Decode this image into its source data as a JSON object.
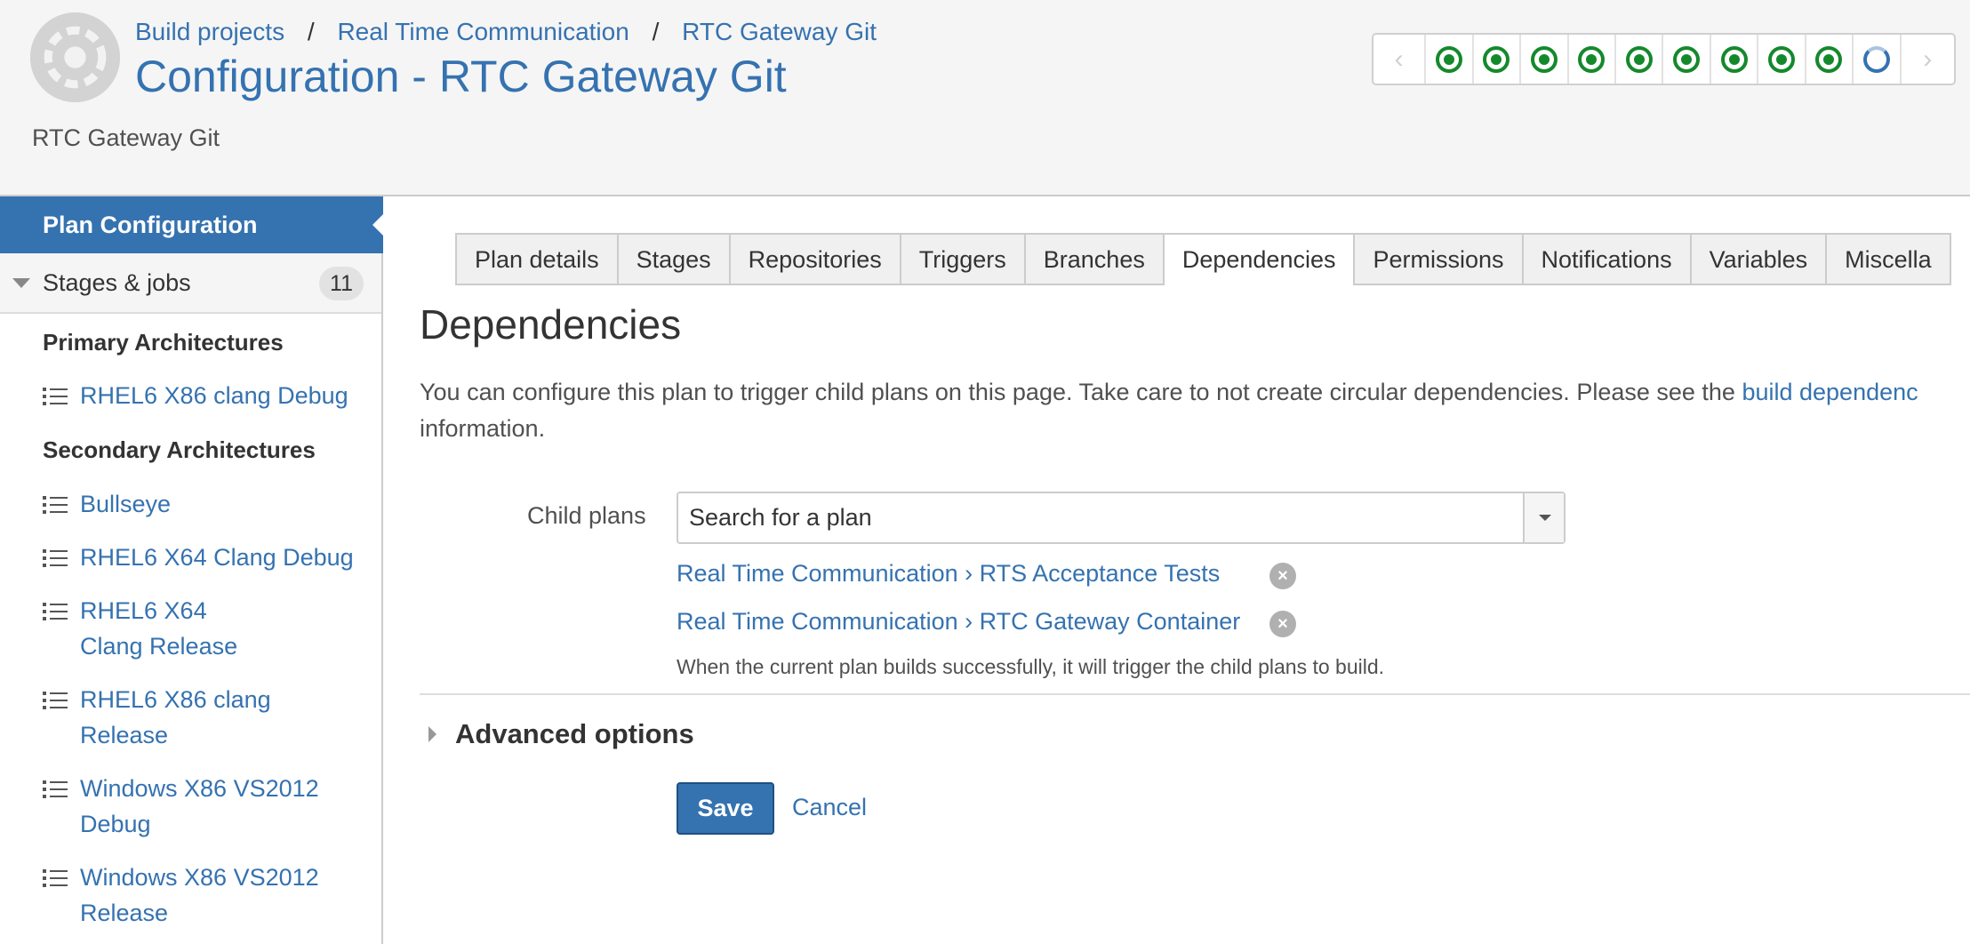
{
  "header": {
    "breadcrumb": [
      "Build projects",
      "Real Time Communication",
      "RTC Gateway Git"
    ],
    "separator": "/",
    "title": "Configuration - RTC Gateway Git",
    "subtitle": "RTC Gateway Git",
    "build_history": {
      "prev_icon": "chevron-left-icon",
      "next_icon": "chevron-right-icon",
      "builds": [
        "success",
        "success",
        "success",
        "success",
        "success",
        "success",
        "success",
        "success",
        "success",
        "in-progress"
      ]
    }
  },
  "sidebar": {
    "active_item": "Plan Configuration",
    "stages": {
      "label": "Stages & jobs",
      "count": "11"
    },
    "groups": [
      {
        "label": "Primary Architectures",
        "jobs": [
          "RHEL6 X86 clang Debug"
        ]
      },
      {
        "label": "Secondary Architectures",
        "jobs": [
          "Bullseye",
          "RHEL6 X64 Clang Debug",
          "RHEL6 X64 Clang Release",
          "RHEL6 X86 clang Release",
          "Windows X86 VS2012 Debug",
          "Windows X86 VS2012 Release"
        ]
      }
    ]
  },
  "tabs": [
    "Plan details",
    "Stages",
    "Repositories",
    "Triggers",
    "Branches",
    "Dependencies",
    "Permissions",
    "Notifications",
    "Variables",
    "Miscella"
  ],
  "active_tab": "Dependencies",
  "main": {
    "heading": "Dependencies",
    "description_before": "You can configure this plan to trigger child plans on this page. Take care to not create circular dependencies. Please see the ",
    "description_link": "build dependenc",
    "description_after": "information.",
    "child_plans": {
      "label": "Child plans",
      "placeholder": "Search for a plan",
      "items": [
        "Real Time Communication › RTS Acceptance Tests",
        "Real Time Communication › RTC Gateway Container"
      ],
      "help": "When the current plan builds successfully, it will trigger the child plans to build."
    },
    "advanced": "Advanced options",
    "save": "Save",
    "cancel": "Cancel"
  },
  "colors": {
    "accent": "#3572b0",
    "success": "#14892c",
    "header_bg": "#f5f5f5"
  }
}
